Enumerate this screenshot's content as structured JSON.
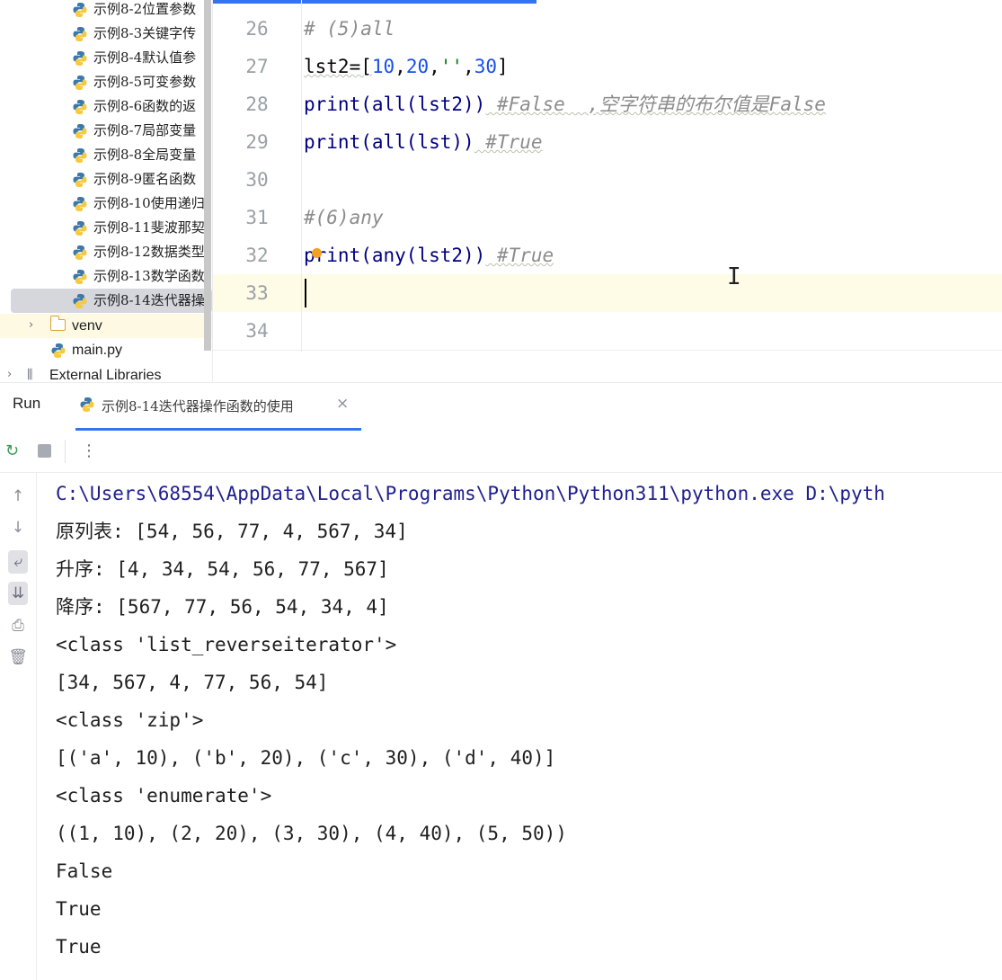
{
  "project_tree": {
    "items": [
      {
        "label": "示例8-2位置参数",
        "type": "file"
      },
      {
        "label": "示例8-3关键字传",
        "type": "file"
      },
      {
        "label": "示例8-4默认值参",
        "type": "file"
      },
      {
        "label": "示例8-5可变参数",
        "type": "file"
      },
      {
        "label": "示例8-6函数的返",
        "type": "file"
      },
      {
        "label": "示例8-7局部变量",
        "type": "file"
      },
      {
        "label": "示例8-8全局变量",
        "type": "file"
      },
      {
        "label": "示例8-9匿名函数",
        "type": "file"
      },
      {
        "label": "示例8-10使用递归",
        "type": "file"
      },
      {
        "label": "示例8-11斐波那契",
        "type": "file"
      },
      {
        "label": "示例8-12数据类型",
        "type": "file"
      },
      {
        "label": "示例8-13数学函数",
        "type": "file"
      },
      {
        "label": "示例8-14迭代器操",
        "type": "file",
        "selected": true
      }
    ],
    "venv_label": "venv",
    "main_label": "main.py",
    "external_label": "External Libraries"
  },
  "editor": {
    "line_numbers": [
      "26",
      "27",
      "28",
      "29",
      "30",
      "31",
      "32",
      "33",
      "34"
    ],
    "lines": {
      "l26_comment": "# (5)all",
      "l27_a": "lst2=[",
      "l27_n1": "10",
      "l27_c1": ",",
      "l27_n2": "20",
      "l27_c2": ",",
      "l27_s": "''",
      "l27_c3": ",",
      "l27_n3": "30",
      "l27_end": "]",
      "l28_code": "print(all(lst2))",
      "l28_comment": " #False  ,空字符串的布尔值是False",
      "l29_code": "print(all(lst))",
      "l29_comment": " #True",
      "l31_comment": "#(6)any",
      "l32_code": "print(any(lst2))",
      "l32_comment": " #True"
    }
  },
  "run": {
    "label": "Run",
    "tab_title": "示例8-14迭代器操作函数的使用",
    "tab_close": "×",
    "console": [
      "C:\\Users\\68554\\AppData\\Local\\Programs\\Python\\Python311\\python.exe D:\\pyth",
      "原列表: [54, 56, 77, 4, 567, 34]",
      "升序: [4, 34, 54, 56, 77, 567]",
      "降序: [567, 77, 56, 54, 34, 4]",
      "<class 'list_reverseiterator'>",
      "[34, 567, 4, 77, 56, 54]",
      "<class 'zip'>",
      "[('a', 10), ('b', 20), ('c', 30), ('d', 40)]",
      "<class 'enumerate'>",
      "((1, 10), (2, 20), (3, 30), (4, 40), (5, 50))",
      "False",
      "True",
      "True"
    ]
  },
  "colors": {
    "accent": "#3574f0",
    "number": "#1750eb",
    "string": "#067d17",
    "comment": "#8c8c8c",
    "current_line": "#fefbe6"
  }
}
